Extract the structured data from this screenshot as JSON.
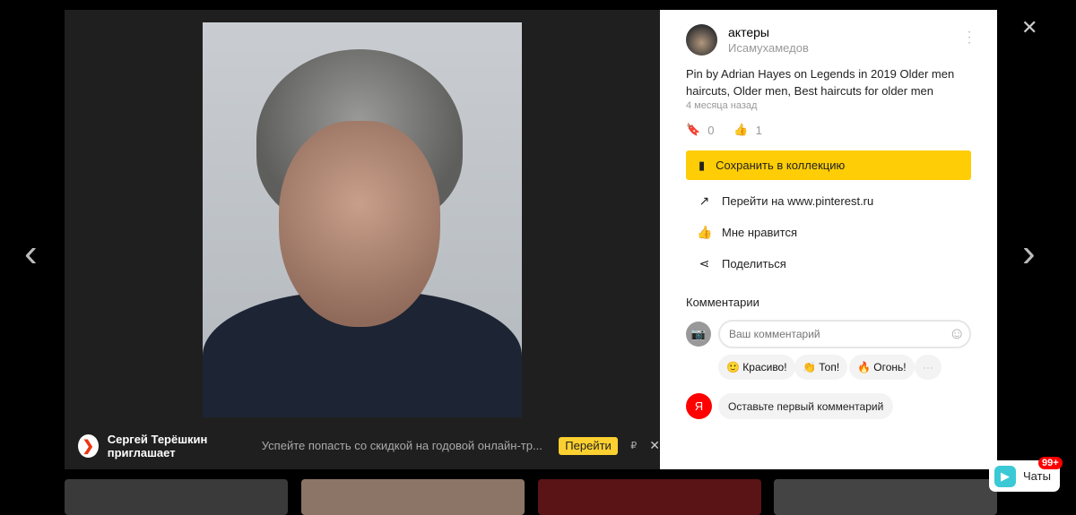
{
  "viewer": {
    "ad": {
      "sender": "Сергей Терёшкин приглашает",
      "text": "Успейте попасть со скидкой на годовой онлайн-тр...",
      "button": "Перейти",
      "currency": "₽"
    }
  },
  "post": {
    "collection": "актеры",
    "user": "Исамухамедов",
    "description": "Pin by Adrian Hayes on Legends in 2019 Older men haircuts, Older men, Best haircuts for older men",
    "time": "4 месяца назад",
    "saves": "0",
    "likes": "1"
  },
  "actions": {
    "save": "Сохранить в коллекцию",
    "goto": "Перейти на www.pinterest.ru",
    "like": "Мне нравится",
    "share": "Поделиться"
  },
  "comments": {
    "title": "Комментарии",
    "placeholder": "Ваш комментарий",
    "chips": [
      "🙂 Красиво!",
      "👏 Топ!",
      "🔥 Огонь!"
    ],
    "first": "Оставьте первый комментарий",
    "ya": "Я"
  },
  "chats": {
    "label": "Чаты",
    "badge": "99+"
  }
}
